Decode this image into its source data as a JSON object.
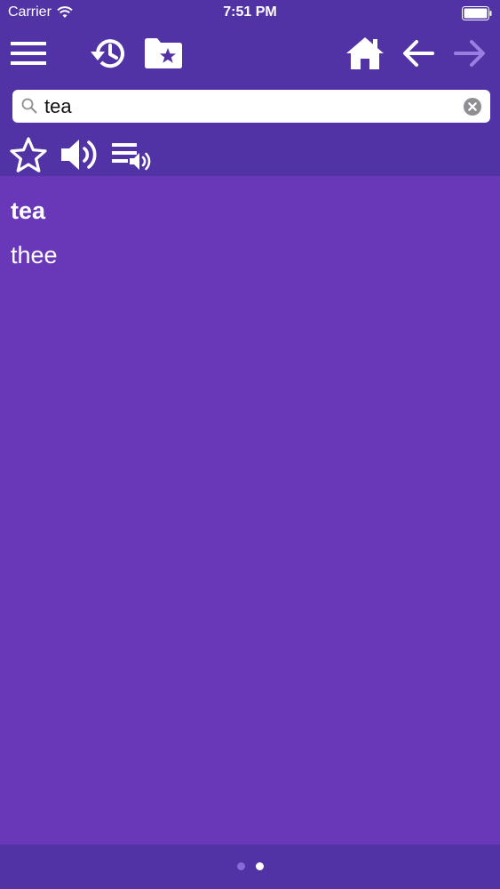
{
  "status_bar": {
    "carrier": "Carrier",
    "time": "7:51 PM"
  },
  "toolbar": {
    "icons": [
      "menu-icon",
      "history-icon",
      "favorites-folder-icon",
      "home-icon",
      "back-arrow-icon",
      "forward-arrow-icon"
    ],
    "forward_disabled": true
  },
  "search": {
    "value": "tea",
    "placeholder": ""
  },
  "actions": {
    "icons": [
      "star-icon",
      "speaker-icon",
      "playlist-audio-icon"
    ]
  },
  "entry": {
    "headword": "tea",
    "translation": "thee"
  },
  "pager": {
    "count": 2,
    "active_index": 1
  },
  "colors": {
    "header_bg": "#5233a6",
    "content_bg": "#6838b8",
    "forward_disabled": "#9b7fe0"
  }
}
